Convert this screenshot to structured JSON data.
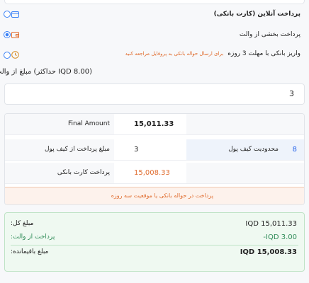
{
  "payment_options": [
    {
      "label": "پرداخت آنلاین (کارت بانکی)",
      "checked": false,
      "icon": "credit-card-icon"
    },
    {
      "label": "پرداخت بخشی از والت",
      "checked": true,
      "icon": "wallet-icon"
    },
    {
      "label": "واریز بانکی با مهلت 3 روزه",
      "note": "برای ارسال حواله بانکی به پروفایل مراجعه کنید",
      "checked": false,
      "icon": "clock-icon"
    }
  ],
  "wallet_amount": {
    "label": "مبلغ از والت (حداکثر IQD 8.00)",
    "value": "3"
  },
  "summary": {
    "final_amount_label": "Final Amount",
    "final_amount_value": "15,011.33",
    "wallet_payment_label": "مبلغ پرداخت از کیف پول",
    "wallet_payment_value": "3",
    "wallet_limit_label": "محدودیت کیف پول",
    "wallet_limit_value": "8",
    "card_payment_label": "پرداخت کارت بانکی",
    "card_payment_value": "15,008.33",
    "warning": "پرداخت در حواله بانکی یا موقعیت سه روزه"
  },
  "totals": {
    "total_label": "مبلغ کل:",
    "total_value": "IQD 15,011.33",
    "wallet_label": "پرداخت از والت:",
    "wallet_value": "-IQD 3.00",
    "remaining_label": "مبلغ باقیمانده:",
    "remaining_value": "IQD 15,008.33"
  },
  "colors": {
    "accent_blue": "#3b82f6",
    "warning_orange": "#e06c2e",
    "success_green": "#2e8b57"
  }
}
